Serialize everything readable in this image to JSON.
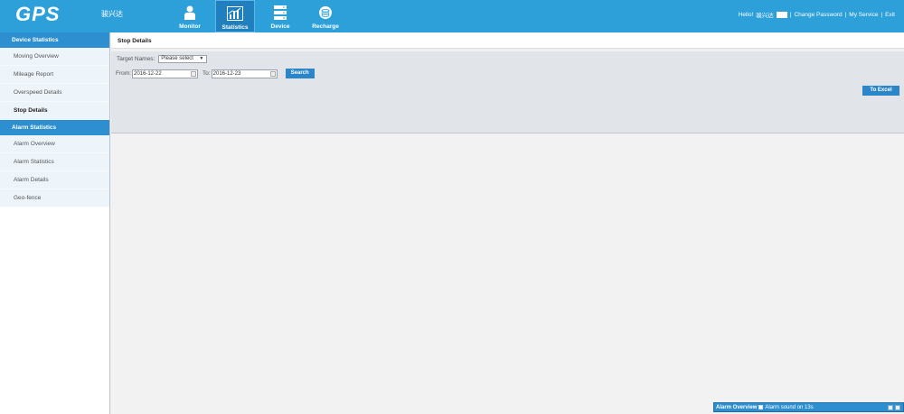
{
  "header": {
    "logo": "GPS",
    "brand": "骏兴达",
    "nav": [
      {
        "label": "Monitor",
        "icon": "person-icon"
      },
      {
        "label": "Statistics",
        "icon": "chart-icon"
      },
      {
        "label": "Device",
        "icon": "server-icon"
      },
      {
        "label": "Recharge",
        "icon": "coins-icon"
      }
    ],
    "user": {
      "greeting": "Hello!",
      "name": "骏兴达",
      "links_open": "|",
      "change_password": "Change Password",
      "sep1": "|",
      "my_service": "My Service",
      "sep2": "|",
      "exit": "Exit"
    }
  },
  "sidebar": {
    "device_stats_title": "Device Statistics",
    "device_items": [
      "Moving Overview",
      "Mileage Report",
      "Overspeed Details",
      "Stop Details"
    ],
    "alarm_stats_title": "Alarm Statistics",
    "alarm_items": [
      "Alarm Overview",
      "Alarm Statistics",
      "Alarm Details",
      "Geo-fence"
    ]
  },
  "main": {
    "title": "Stop Details",
    "target_label": "Target Names:",
    "target_value": "Please select",
    "from_label": "From:",
    "from_value": "2016-12-22",
    "to_label": "To:",
    "to_value": "2016-12-23",
    "search_label": "Search",
    "excel_label": "To Excel"
  },
  "alarm_bar": {
    "title": "Alarm Overview",
    "sound_label": "Alarm sound on  13s"
  },
  "colors": {
    "header_bg": "#2d9fd9",
    "accent": "#2a86c9",
    "panel_bg": "#e1e4e9"
  }
}
